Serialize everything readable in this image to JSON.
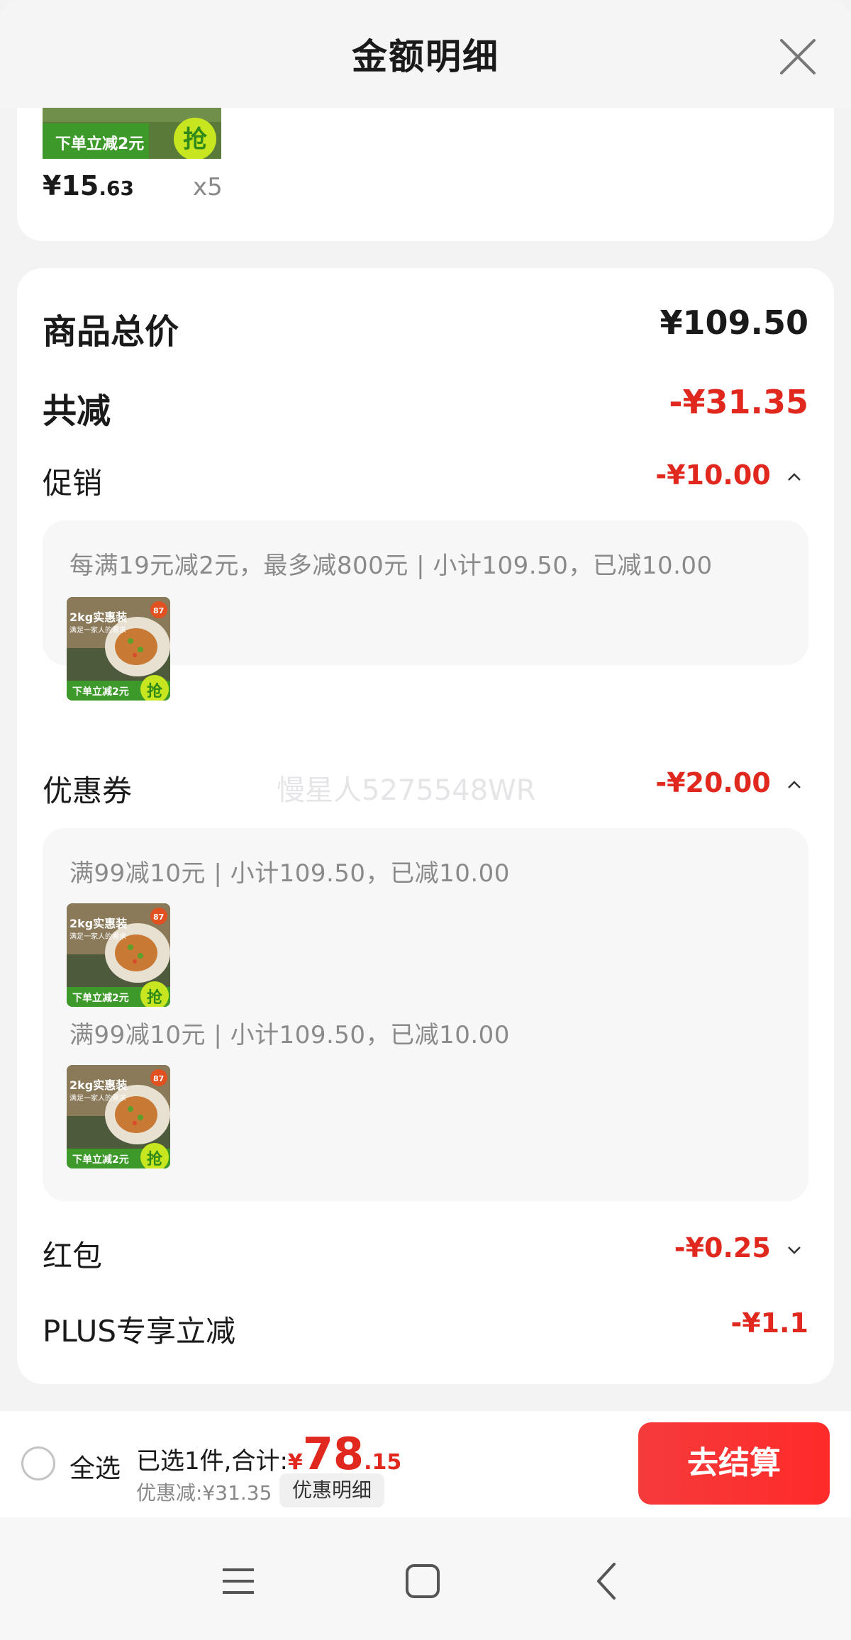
{
  "header": {
    "title": "金额明细"
  },
  "top_product": {
    "promo_banner_text": "下单立减2元",
    "grab_text": "抢",
    "price_main": "¥15",
    "price_decimal": ".63",
    "quantity": "x5"
  },
  "summary": {
    "goods_total_label": "商品总价",
    "goods_total_value": "¥109.50",
    "total_discount_label": "共减",
    "total_discount_value": "-¥31.35"
  },
  "promotion": {
    "label": "促销",
    "value": "-¥10.00",
    "detail": "每满19元减2元，最多减800元 | 小计109.50，已减10.00"
  },
  "coupon": {
    "label": "优惠券",
    "value": "-¥20.00",
    "details": [
      "满99减10元 | 小计109.50，已减10.00",
      "满99减10元 | 小计109.50，已减10.00"
    ]
  },
  "watermark": "慢星人5275548WR",
  "red_packet": {
    "label": "红包",
    "value": "-¥0.25"
  },
  "plus": {
    "label": "PLUS专享立减",
    "value": "-¥1.1"
  },
  "thumb": {
    "headline": "2kg实惠装",
    "subline": "满足一家人的需求",
    "badge": "87",
    "banner": "下单立减2元",
    "grab": "抢"
  },
  "bottom_bar": {
    "select_all": "全选",
    "selected_text": "已选1件,合计:",
    "currency": "¥",
    "amount_int": "78",
    "amount_dec": ".15",
    "discount_text": "优惠减:¥31.35",
    "detail_link": "优惠明细",
    "checkout": "去结算"
  },
  "colors": {
    "accent_red": "#e0281f",
    "checkout_red": "#f53b3b",
    "promo_green": "#4caf2a"
  },
  "icons": [
    "close-icon",
    "chevron-up-icon",
    "chevron-down-icon",
    "menu-icon",
    "home-icon",
    "back-icon"
  ]
}
